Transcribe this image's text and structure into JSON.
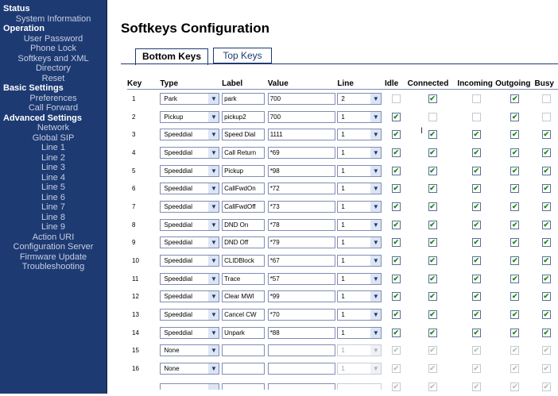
{
  "sidebar": {
    "sections": [
      {
        "label": "Status",
        "items": [
          "System Information"
        ]
      },
      {
        "label": "Operation",
        "items": [
          "User Password",
          "Phone Lock",
          "Softkeys and XML",
          "Directory",
          "Reset"
        ]
      },
      {
        "label": "Basic Settings",
        "items": [
          "Preferences",
          "Call Forward"
        ]
      },
      {
        "label": "Advanced Settings",
        "items": [
          "Network",
          "Global SIP",
          "Line 1",
          "Line 2",
          "Line 3",
          "Line 4",
          "Line 5",
          "Line 6",
          "Line 7",
          "Line 8",
          "Line 9",
          "Action URI",
          "Configuration Server",
          "Firmware Update",
          "Troubleshooting"
        ]
      }
    ]
  },
  "page": {
    "title": "Softkeys Configuration"
  },
  "tabs": [
    {
      "label": "Bottom Keys",
      "active": true
    },
    {
      "label": "Top Keys",
      "active": false
    }
  ],
  "table": {
    "headers": [
      "Key",
      "Type",
      "Label",
      "Value",
      "Line",
      "Idle",
      "Connected",
      "Incoming",
      "Outgoing",
      "Busy"
    ],
    "rows": [
      {
        "key": "1",
        "type": "Park",
        "label": "park",
        "value": "700",
        "line": "2",
        "line_enabled": true,
        "states": [
          false,
          true,
          false,
          true,
          false
        ],
        "states_enabled": [
          false,
          true,
          false,
          true,
          false
        ]
      },
      {
        "key": "2",
        "type": "Pickup",
        "label": "pickup2",
        "value": "700",
        "line": "1",
        "line_enabled": true,
        "states": [
          true,
          false,
          false,
          true,
          false
        ],
        "states_enabled": [
          true,
          false,
          false,
          true,
          false
        ]
      },
      {
        "key": "3",
        "type": "Speeddial",
        "label": "Speed Dial",
        "value": "1111",
        "line": "1",
        "line_enabled": true,
        "states": [
          true,
          true,
          true,
          true,
          true
        ],
        "states_enabled": [
          true,
          true,
          true,
          true,
          true
        ]
      },
      {
        "key": "4",
        "type": "Speeddial",
        "label": "Call Return",
        "value": "*69",
        "line": "1",
        "line_enabled": true,
        "states": [
          true,
          true,
          true,
          true,
          true
        ],
        "states_enabled": [
          true,
          true,
          true,
          true,
          true
        ]
      },
      {
        "key": "5",
        "type": "Speeddial",
        "label": "Pickup",
        "value": "*98",
        "line": "1",
        "line_enabled": true,
        "states": [
          true,
          true,
          true,
          true,
          true
        ],
        "states_enabled": [
          true,
          true,
          true,
          true,
          true
        ]
      },
      {
        "key": "6",
        "type": "Speeddial",
        "label": "CallFwdOn",
        "value": "*72",
        "line": "1",
        "line_enabled": true,
        "states": [
          true,
          true,
          true,
          true,
          true
        ],
        "states_enabled": [
          true,
          true,
          true,
          true,
          true
        ]
      },
      {
        "key": "7",
        "type": "Speeddial",
        "label": "CallFwdOff",
        "value": "*73",
        "line": "1",
        "line_enabled": true,
        "states": [
          true,
          true,
          true,
          true,
          true
        ],
        "states_enabled": [
          true,
          true,
          true,
          true,
          true
        ]
      },
      {
        "key": "8",
        "type": "Speeddial",
        "label": "DND On",
        "value": "*78",
        "line": "1",
        "line_enabled": true,
        "states": [
          true,
          true,
          true,
          true,
          true
        ],
        "states_enabled": [
          true,
          true,
          true,
          true,
          true
        ]
      },
      {
        "key": "9",
        "type": "Speeddial",
        "label": "DND Off",
        "value": "*79",
        "line": "1",
        "line_enabled": true,
        "states": [
          true,
          true,
          true,
          true,
          true
        ],
        "states_enabled": [
          true,
          true,
          true,
          true,
          true
        ]
      },
      {
        "key": "10",
        "type": "Speeddial",
        "label": "CLIDBlock",
        "value": "*67",
        "line": "1",
        "line_enabled": true,
        "states": [
          true,
          true,
          true,
          true,
          true
        ],
        "states_enabled": [
          true,
          true,
          true,
          true,
          true
        ]
      },
      {
        "key": "11",
        "type": "Speeddial",
        "label": "Trace",
        "value": "*57",
        "line": "1",
        "line_enabled": true,
        "states": [
          true,
          true,
          true,
          true,
          true
        ],
        "states_enabled": [
          true,
          true,
          true,
          true,
          true
        ]
      },
      {
        "key": "12",
        "type": "Speeddial",
        "label": "Clear MWI",
        "value": "*99",
        "line": "1",
        "line_enabled": true,
        "states": [
          true,
          true,
          true,
          true,
          true
        ],
        "states_enabled": [
          true,
          true,
          true,
          true,
          true
        ]
      },
      {
        "key": "13",
        "type": "Speeddial",
        "label": "Cancel CW",
        "value": "*70",
        "line": "1",
        "line_enabled": true,
        "states": [
          true,
          true,
          true,
          true,
          true
        ],
        "states_enabled": [
          true,
          true,
          true,
          true,
          true
        ]
      },
      {
        "key": "14",
        "type": "Speeddial",
        "label": "Unpark",
        "value": "*88",
        "line": "1",
        "line_enabled": true,
        "states": [
          true,
          true,
          true,
          true,
          true
        ],
        "states_enabled": [
          true,
          true,
          true,
          true,
          true
        ]
      },
      {
        "key": "15",
        "type": "None",
        "label": "",
        "value": "",
        "line": "1",
        "line_enabled": false,
        "states": [
          true,
          true,
          true,
          true,
          true
        ],
        "states_enabled": [
          false,
          false,
          false,
          false,
          false
        ]
      },
      {
        "key": "16",
        "type": "None",
        "label": "",
        "value": "",
        "line": "1",
        "line_enabled": false,
        "states": [
          true,
          true,
          true,
          true,
          true
        ],
        "states_enabled": [
          false,
          false,
          false,
          false,
          false
        ]
      },
      {
        "key": "",
        "type": "",
        "label": "",
        "value": "",
        "line": "",
        "line_enabled": false,
        "states": [
          true,
          true,
          true,
          true,
          true
        ],
        "states_enabled": [
          false,
          false,
          false,
          false,
          false
        ]
      }
    ]
  },
  "colors": {
    "sidebar_bg": "#1d3a73",
    "check_green": "#1a8a1a"
  }
}
